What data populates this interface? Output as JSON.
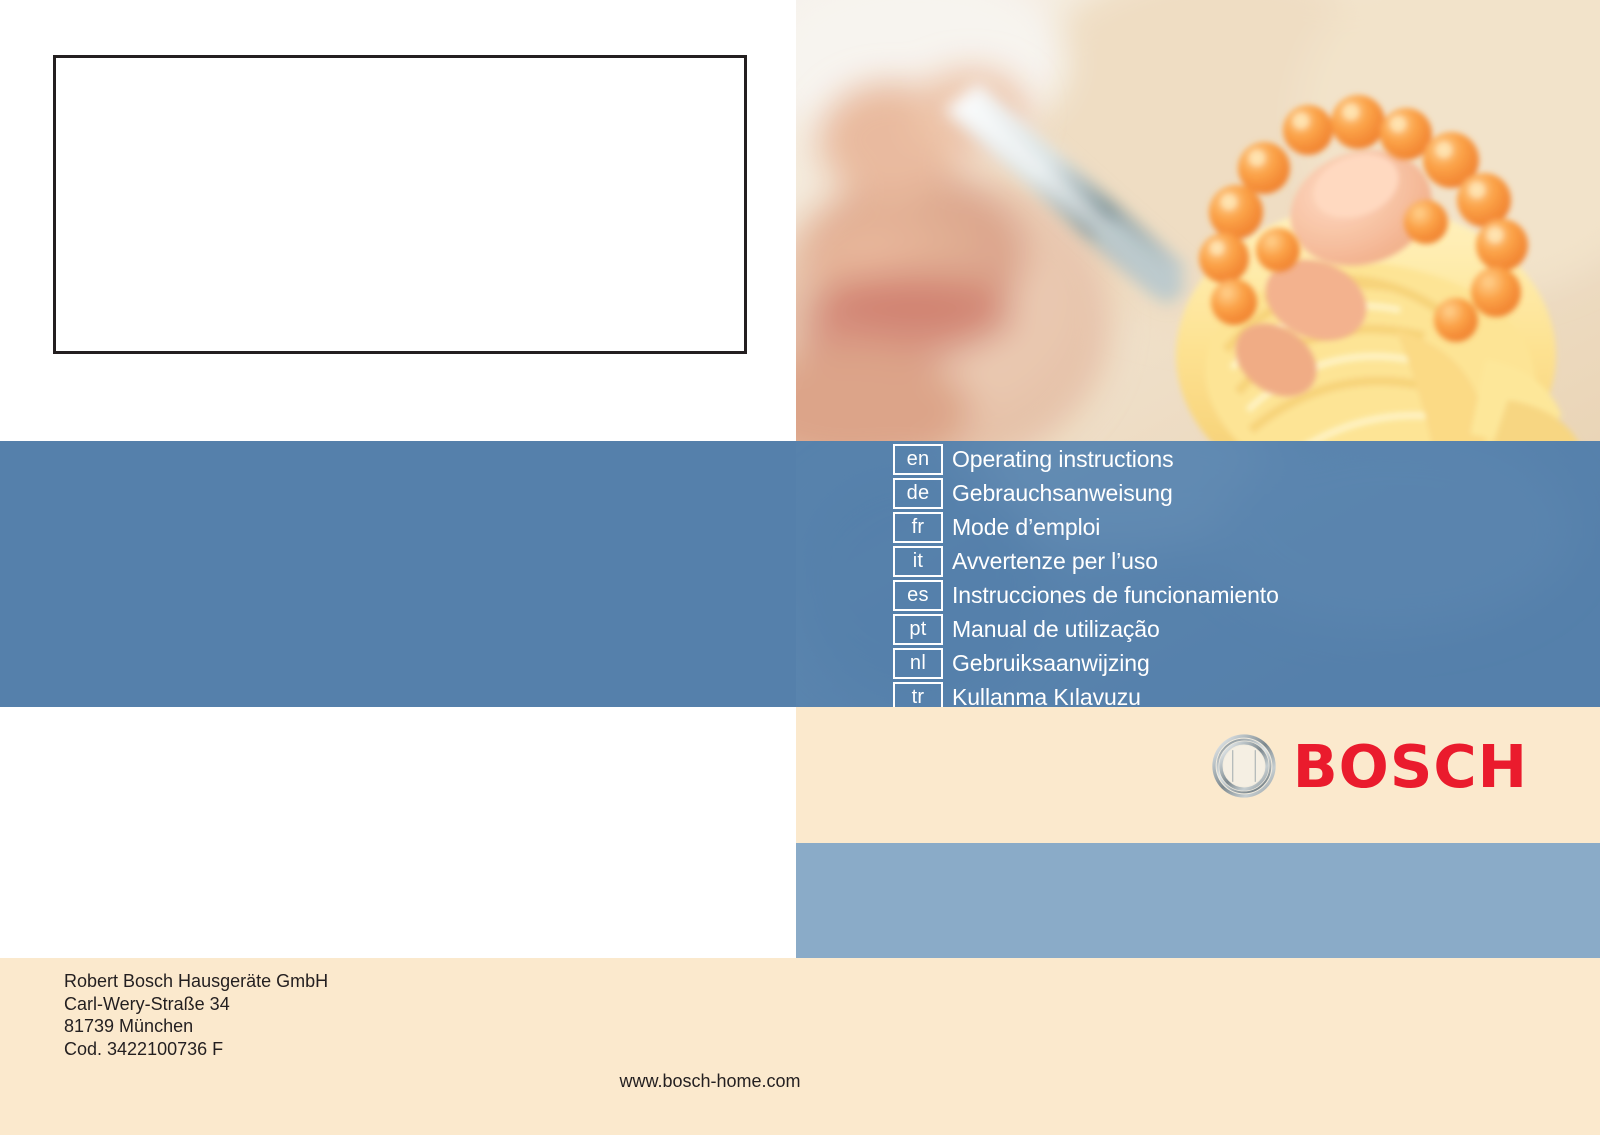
{
  "document": {
    "kind": "appliance-manual-cover",
    "brand": "BOSCH"
  },
  "photo": {
    "alt_name": "person-eating-spaghetti-photo",
    "description": "Blurred close-up photo of a person eating spaghetti with salmon and roe on a fork"
  },
  "languages": [
    {
      "code": "en",
      "label": "Operating  instructions"
    },
    {
      "code": "de",
      "label": "Gebrauchsanweisung"
    },
    {
      "code": "fr",
      "label": "Mode d’emploi"
    },
    {
      "code": "it",
      "label": "Avvertenze per l’uso"
    },
    {
      "code": "es",
      "label": "Instrucciones de funcionamiento"
    },
    {
      "code": "pt",
      "label": "Manual de utilização"
    },
    {
      "code": "nl",
      "label": "Gebruiksaanwijzing"
    },
    {
      "code": "tr",
      "label": "Kullanma Kılavuzu"
    }
  ],
  "logo": {
    "wordmark": "BOSCH",
    "mark_name": "bosch-armature-icon"
  },
  "footer": {
    "address": [
      "Robert Bosch Hausgeräte GmbH",
      "Carl-Wery-Straße 34",
      "81739 München",
      "Cod. 3422100736 F"
    ],
    "website": "www.bosch-home.com"
  },
  "colors": {
    "blue_dark": "#5580ab",
    "blue_light": "#8aabc8",
    "cream": "#fbe9cd",
    "red": "#ea1b2d",
    "ink": "#231f20",
    "white": "#ffffff"
  }
}
